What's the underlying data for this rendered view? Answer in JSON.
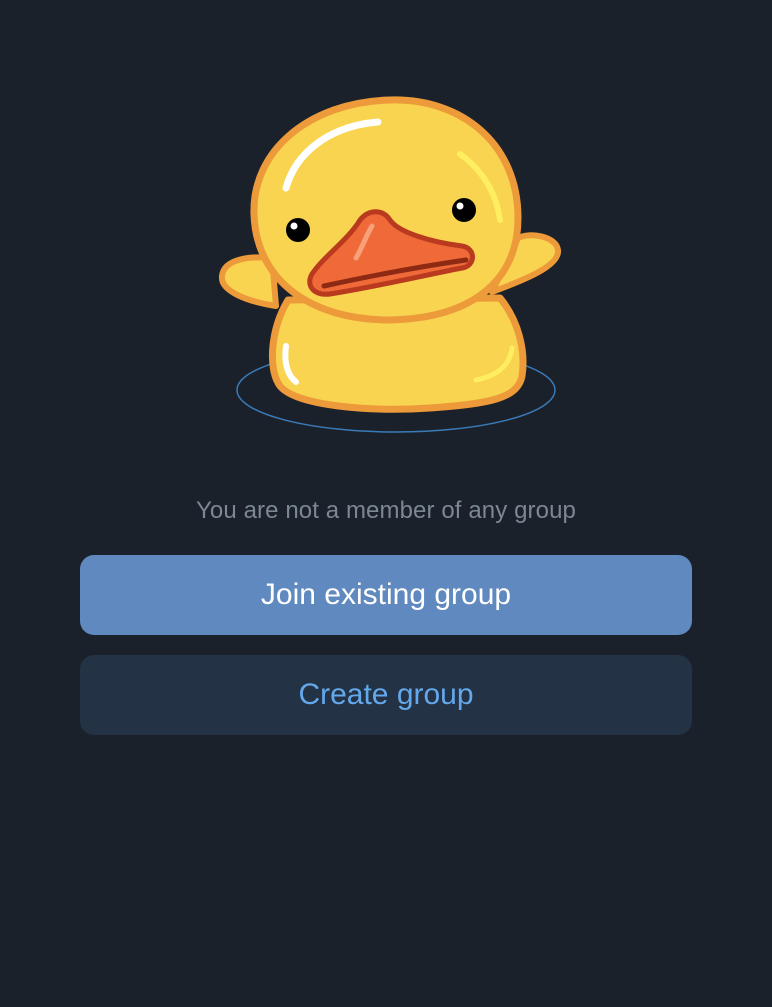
{
  "empty_state": {
    "message": "You are not a member of any group",
    "illustration": "duck-icon"
  },
  "actions": {
    "join_label": "Join existing group",
    "create_label": "Create group"
  },
  "colors": {
    "background": "#1b212a",
    "primary_button": "#5f89bf",
    "secondary_button": "#233244",
    "secondary_text": "#64a8ec",
    "muted_text": "#7c8794"
  }
}
